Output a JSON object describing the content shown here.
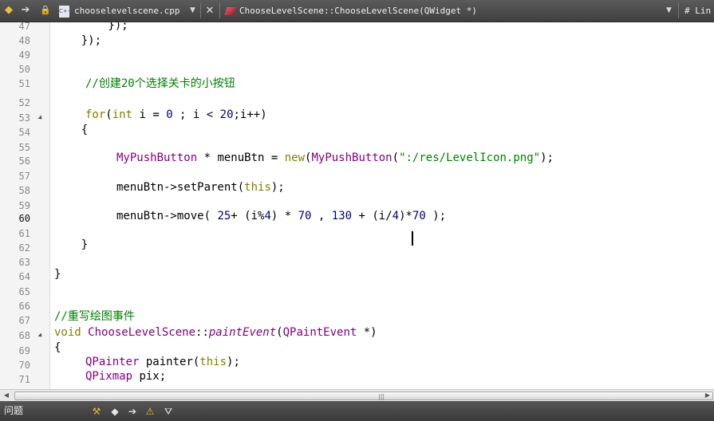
{
  "toolbar": {
    "back_icon": "back-arrow-icon",
    "forward_icon": "forward-arrow-icon",
    "lock_icon": "lock-icon",
    "file_name": "chooselevelscene.cpp",
    "file_badge": "C++",
    "dropdown_glyph": "▼",
    "close_glyph": "✕",
    "symbol": "ChooseLevelScene::ChooseLevelScene(QWidget *)",
    "line_info": "#  Lin"
  },
  "gutter": {
    "line_numbers": [
      "47",
      "48",
      "49",
      "50",
      "51",
      "52",
      "53",
      "54",
      "55",
      "56",
      "57",
      "58",
      "59",
      "60",
      "61",
      "62",
      "63",
      "64",
      "65",
      "66",
      "67",
      "68",
      "69",
      "70",
      "71"
    ],
    "current_line": "60"
  },
  "code": {
    "l47": "        });",
    "l48": "    });",
    "l51_comment": "//创建20个选择关卡的小按钮",
    "l53_for": "for",
    "l53_paren": "(",
    "l53_int": "int",
    "l53_mid": " i = ",
    "l53_zero": "0",
    "l53_mid2": " ; i < ",
    "l53_twenty": "20",
    "l53_end": ";i++)",
    "l54": "    {",
    "l56_type": "MyPushButton",
    "l56_mid": " * menuBtn = ",
    "l56_new": "new",
    "l56_type2": "MyPushButton",
    "l56_open": "(",
    "l56_str": "\":/res/LevelIcon.png\"",
    "l56_close": ");",
    "l58_a": "menuBtn->setParent(",
    "l58_this": "this",
    "l58_b": ");",
    "l60_a": "menuBtn->move( ",
    "l60_n25": "25",
    "l60_b": "+ (i%",
    "l60_n4": "4",
    "l60_c": ") * ",
    "l60_n70": "70",
    "l60_d": " , ",
    "l60_n130": "130",
    "l60_e": " + (i/",
    "l60_n4b": "4",
    "l60_f": ")*",
    "l60_n70b": "70",
    "l60_g": " );",
    "l62": "    }",
    "l64": "}",
    "l67_comment": "//重写绘图事件",
    "l68_void": "void",
    "l68_class": "ChooseLevelScene",
    "l68_sep": "::",
    "l68_method": "paintEvent",
    "l68_open": "(",
    "l68_type": "QPaintEvent",
    "l68_close": " *)",
    "l69": "{",
    "l70_type": "QPainter",
    "l70_mid": " painter(",
    "l70_this": "this",
    "l70_end": ");",
    "l71_type": "QPixmap",
    "l71_end": " pix;"
  },
  "scrollbar": {
    "left_arrow": "◀",
    "right_arrow": "▶",
    "grip": "|||"
  },
  "bottom_panel": {
    "label": "问题",
    "icons": [
      "filter-build-icon",
      "prev-issue-icon",
      "next-issue-icon",
      "warning-icon",
      "filter-icon"
    ]
  },
  "colors": {
    "keyword": "#808000",
    "type": "#800080",
    "number": "#000080",
    "comment": "#008000",
    "string": "#008000"
  }
}
